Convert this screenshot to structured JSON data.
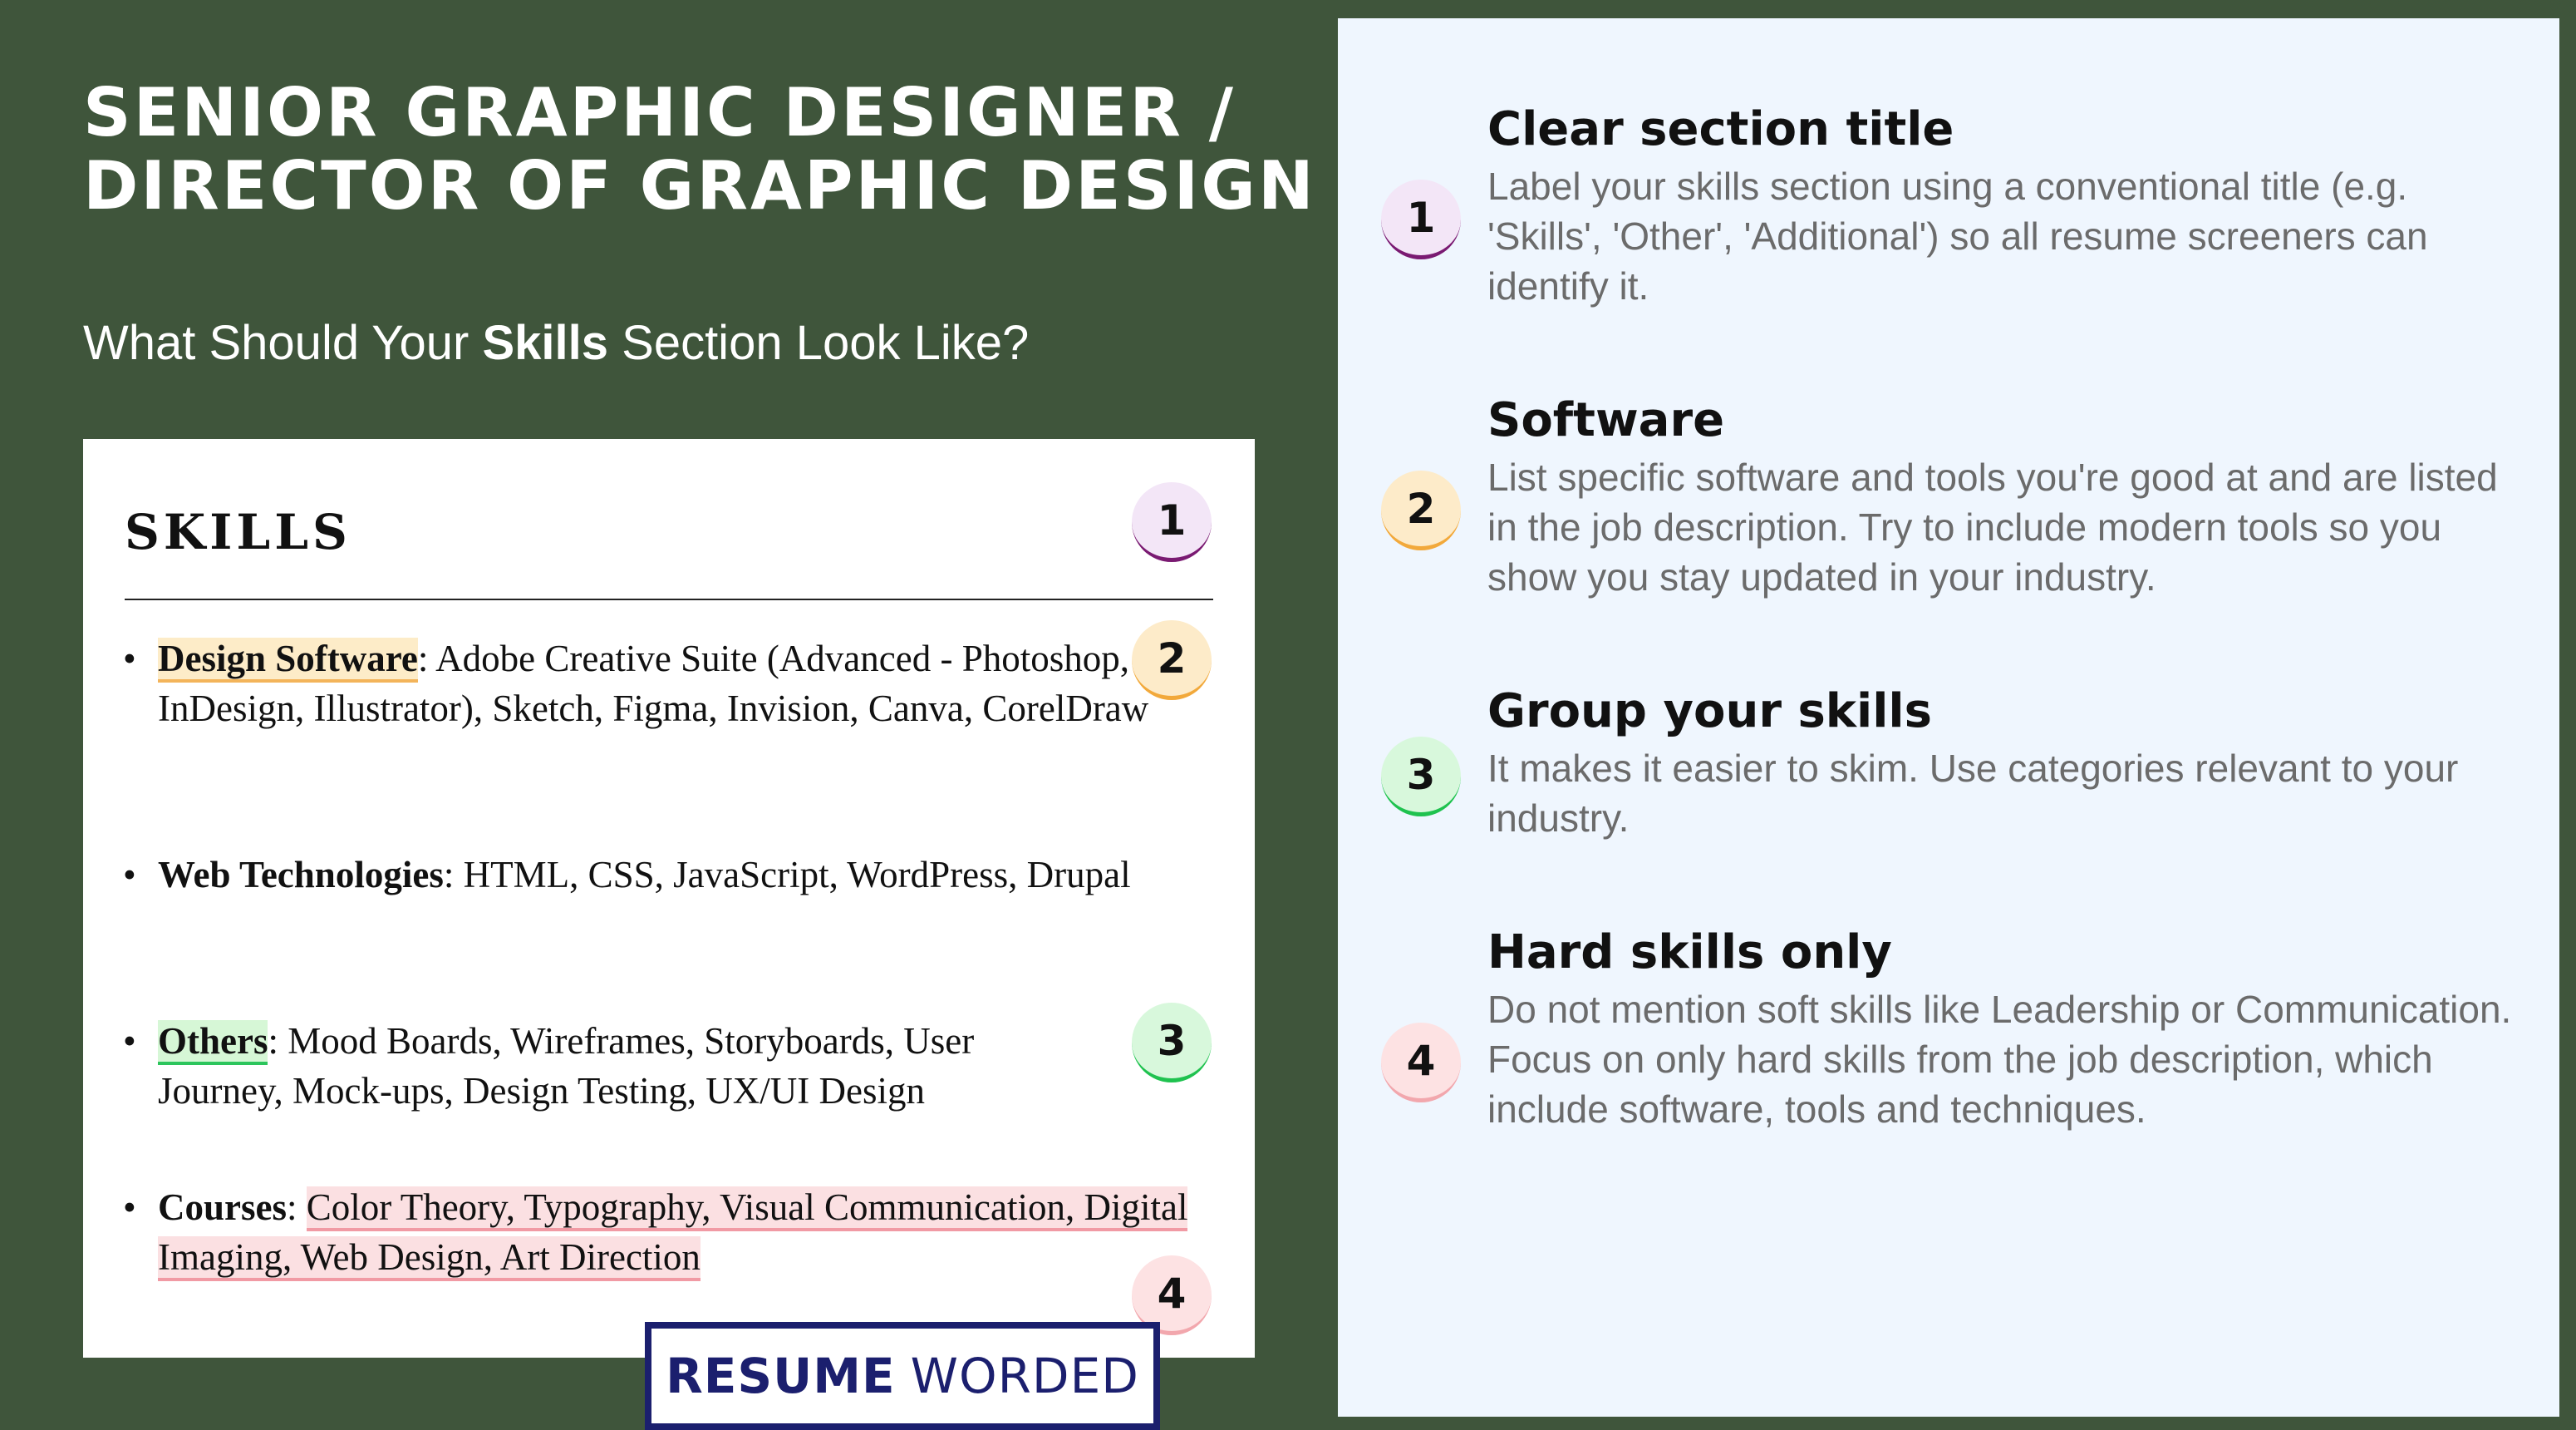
{
  "header": {
    "title": "SENIOR GRAPHIC DESIGNER / DIRECTOR OF GRAPHIC DESIGN",
    "subtitle_pre": "What Should Your ",
    "subtitle_bold": "Skills",
    "subtitle_post": " Section Look Like?"
  },
  "card": {
    "heading": "SKILLS",
    "items": [
      {
        "key": "Design Software",
        "sep": ": ",
        "value": "Adobe Creative Suite (Advanced - Photoshop, InDesign, Illustrator), Sketch, Figma, Invision, Canva, CorelDraw"
      },
      {
        "key": "Web Technologies",
        "sep": ": ",
        "value": "HTML, CSS, JavaScript, WordPress, Drupal"
      },
      {
        "key": "Others",
        "sep": ": ",
        "value": "Mood Boards, Wireframes, Storyboards, User Journey, Mock-ups, Design Testing, UX/UI Design"
      },
      {
        "key": "Courses",
        "sep": ": ",
        "value": "Color Theory, Typography, Visual Communication, Digital Imaging, Web Design, Art Direction"
      }
    ]
  },
  "badges": [
    "1",
    "2",
    "3",
    "4"
  ],
  "tips": [
    {
      "title": "Clear section title",
      "body": "Label your skills section using a conventional title (e.g. 'Skills', 'Other', 'Additional') so all resume screeners can identify it."
    },
    {
      "title": "Software",
      "body": "List specific software and tools you're good at and are listed in the job description. Try to include modern tools so you show you stay updated in your industry."
    },
    {
      "title": "Group your skills",
      "body": "It makes it easier to skim. Use categories relevant to your industry."
    },
    {
      "title": "Hard skills only",
      "body": "Do not mention soft skills like Leadership or Communication. Focus on only hard skills from the job description, which include software, tools and techniques."
    }
  ],
  "logo": {
    "strong": "RESUME",
    "light": "WORDED"
  },
  "colors": {
    "background": "#3f553b",
    "panel": "#eff6fe",
    "logo": "#1b1f6e",
    "badge1": "#7a1a72",
    "badge2": "#f2a93b",
    "badge3": "#1fc24f",
    "badge4": "#f2a7ad"
  }
}
